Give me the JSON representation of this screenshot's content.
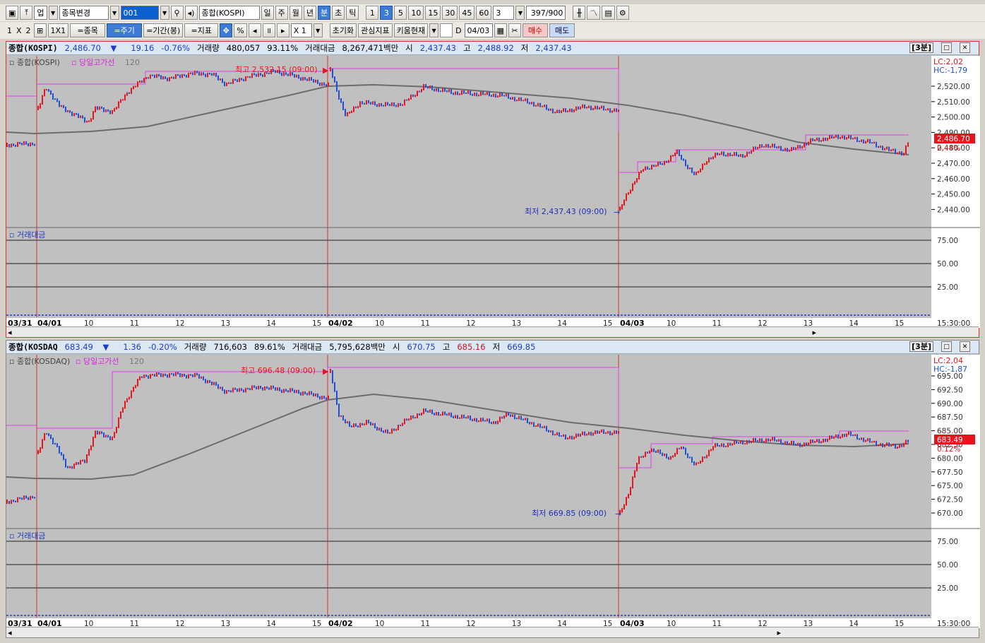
{
  "toolbar1": {
    "type_select": "업",
    "stock_change": "종목변경",
    "code": "001",
    "name_field": "종합(KOSPI)",
    "periods": [
      "일",
      "주",
      "월",
      "년",
      "분",
      "초",
      "틱"
    ],
    "active_period": "분",
    "minutes": [
      "1",
      "3",
      "5",
      "10",
      "15",
      "30",
      "45",
      "60"
    ],
    "active_minute": "3",
    "interval_value": "3",
    "count": "397",
    "count_total": "/900"
  },
  "toolbar2": {
    "layout_1": "1",
    "layout_x": "X",
    "layout_2": "2",
    "one_by_one": "1X1",
    "btn_stock": "=종목",
    "btn_period": "=주기",
    "btn_range": "=기간(봉)",
    "btn_indicator": "=지표",
    "percent": "%",
    "multiplier": "X 1",
    "reset": "초기화",
    "interest": "관심지표",
    "kiwoom": "키움현재",
    "d_label": "D",
    "date": "04/03",
    "buy": "매수",
    "sell": "매도"
  },
  "panel1": {
    "name": "종합(KOSPI)",
    "price": "2,486.70",
    "arrow": "▼",
    "change": "19.16",
    "rate": "-0.76%",
    "vol_label": "거래량",
    "volume": "480,057",
    "vol_ratio": "93.11%",
    "amount_label": "거래대금",
    "amount": "8,267,471백만",
    "open_label": "시",
    "open": "2,437.43",
    "high_label": "고",
    "high": "2,488.92",
    "low_label": "저",
    "low": "2,437.43",
    "timeframe": "[3분]",
    "legend_series": "종합(KOSPI)",
    "legend_line": "당일고가선",
    "legend_ma": "120",
    "lc": "LC:2,02",
    "hc": "HC:-1,79",
    "last_price_label": "2,486.70",
    "last_pct": "0.44%",
    "max_annotation": "최고 2,532.15 (09:00)",
    "min_annotation": "최저 2,437.43 (09:00)",
    "sub_title": "거래대금",
    "yticks": [
      "2,520.00",
      "2,510.00",
      "2,500.00",
      "2,490.00",
      "2,480.00",
      "2,470.00",
      "2,460.00",
      "2,450.00",
      "2,440.00"
    ],
    "sub_yticks": [
      "75.00",
      "50.00",
      "25.00"
    ],
    "time_end": "15:30:00"
  },
  "panel2": {
    "name": "종합(KOSDAQ",
    "price": "683.49",
    "arrow": "▼",
    "change": "1.36",
    "rate": "-0.20%",
    "vol_label": "거래량",
    "volume": "716,603",
    "vol_ratio": "89.61%",
    "amount_label": "거래대금",
    "amount": "5,795,628백만",
    "open_label": "시",
    "open": "670.75",
    "high_label": "고",
    "high": "685.16",
    "low_label": "저",
    "low": "669.85",
    "timeframe": "[3분]",
    "legend_series": "종합(KOSDAQ)",
    "legend_line": "당일고가선",
    "legend_ma": "120",
    "lc": "LC:2,04",
    "hc": "HC:-1,87",
    "last_price_label": "683.49",
    "last_pct": "0.12%",
    "max_annotation": "최고 696.48 (09:00)",
    "min_annotation": "최저 669.85 (09:00)",
    "sub_title": "거래대금",
    "yticks": [
      "695.00",
      "692.50",
      "690.00",
      "687.50",
      "685.00",
      "682.50",
      "680.00",
      "677.50",
      "675.00",
      "672.50",
      "670.00"
    ],
    "sub_yticks": [
      "75.00",
      "50.00",
      "25.00"
    ],
    "time_end": "15:30:00"
  },
  "xaxis": {
    "dates": [
      "03/31",
      "04/01",
      "04/02",
      "04/03"
    ],
    "hours_day": [
      "10",
      "11",
      "12",
      "13",
      "14",
      "15"
    ]
  },
  "colors": {
    "up": "#e8141c",
    "down": "#1e4fd8",
    "high_line": "#e040e0",
    "ma": "#6c6c6c",
    "day_sep": "#d83030"
  }
}
